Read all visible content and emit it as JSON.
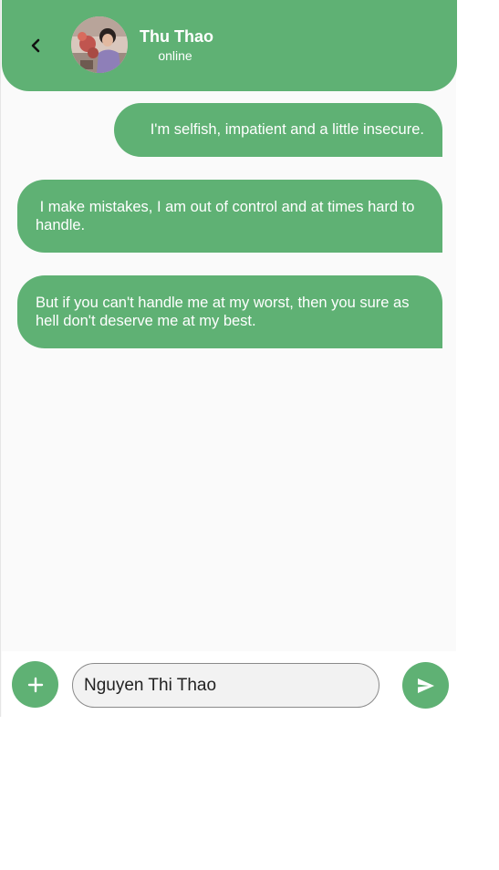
{
  "header": {
    "contact_name": "Thu Thao",
    "status": "online",
    "back_icon": "chevron-left-icon",
    "bg_color": "#5fb174"
  },
  "messages": [
    {
      "text": "I'm selfish, impatient and a little insecure."
    },
    {
      "text": " I make mistakes, I am out of control and at times hard to handle."
    },
    {
      "text": "But if you can't handle me at my worst, then you sure as hell don't deserve me at my best."
    }
  ],
  "composer": {
    "input_value": "Nguyen Thi Thao",
    "add_icon": "plus-icon",
    "send_icon": "send-icon"
  },
  "colors": {
    "accent": "#5fb174",
    "background": "#fafafa",
    "text_on_accent": "#ffffff"
  }
}
